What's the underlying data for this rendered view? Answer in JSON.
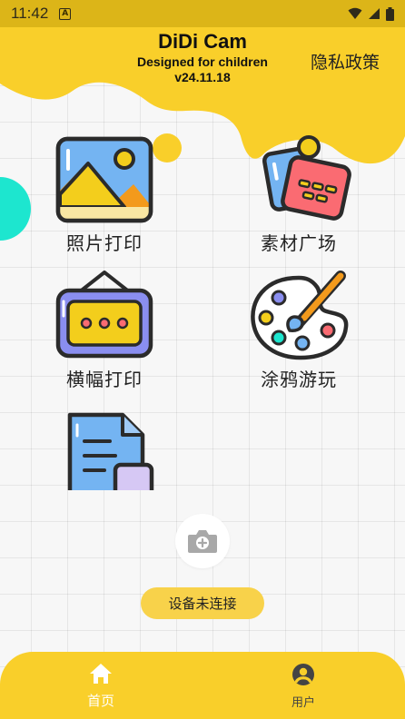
{
  "status_bar": {
    "time": "11:42",
    "notification_icon": "A"
  },
  "header": {
    "title": "DiDi Cam",
    "subtitle": "Designed for children",
    "version": "v24.11.18",
    "privacy_link": "隐私政策"
  },
  "features": [
    {
      "label": "照片打印",
      "icon": "photo-icon"
    },
    {
      "label": "素材广场",
      "icon": "material-icon"
    },
    {
      "label": "横幅打印",
      "icon": "banner-icon"
    },
    {
      "label": "涂鸦游玩",
      "icon": "palette-icon"
    },
    {
      "label": "",
      "icon": "document-icon"
    }
  ],
  "device": {
    "connection_status": "设备未连接"
  },
  "bottom_nav": {
    "items": [
      {
        "label": "首页",
        "icon": "home-icon",
        "active": true
      },
      {
        "label": "用户",
        "icon": "user-icon",
        "active": false
      }
    ]
  },
  "colors": {
    "brand_yellow": "#f9cf2a",
    "status_bar": "#dcb518",
    "accent_teal": "#1de6cf"
  }
}
